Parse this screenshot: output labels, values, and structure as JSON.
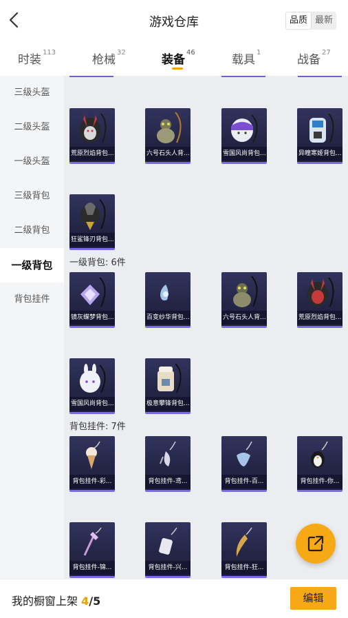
{
  "header": {
    "title": "游戏仓库",
    "sort_options": [
      "品质",
      "最新"
    ],
    "sort_active": "品质"
  },
  "tabs": [
    {
      "label": "时装",
      "count": "113"
    },
    {
      "label": "枪械",
      "count": "32"
    },
    {
      "label": "装备",
      "count": "46",
      "active": true
    },
    {
      "label": "载具",
      "count": "1"
    },
    {
      "label": "战备",
      "count": "27"
    }
  ],
  "sidebar": {
    "items": [
      "三级头盔",
      "二级头盔",
      "一级头盔",
      "三级背包",
      "二级背包",
      "一级背包",
      "背包挂件"
    ],
    "active": "一级背包"
  },
  "sections": {
    "level1_backpack_label": "一级背包: 6件",
    "pendant_label": "背包挂件: 7件"
  },
  "items": {
    "lv2_backpacks": [
      "荒原烈焰背包...",
      "六号石头人背...",
      "雪国风尚背包...",
      "异瞳寒姬背包...",
      "狂鲨锋刃背包..."
    ],
    "lv1_backpacks": [
      "镜灰蝶梦背包...",
      "百变纱华背包...",
      "六号石头人背...",
      "荒原烈焰背包...",
      "雪国风尚背包...",
      "极意攀锋背包..."
    ],
    "pendants": [
      "背包挂件-彩...",
      "背包挂件-鸢...",
      "背包挂件-百...",
      "背包挂件-你...",
      "背包挂件-锦...",
      "背包挂件-兴...",
      "背包挂件-狂..."
    ]
  },
  "bottom": {
    "showcase_label": "我的橱窗上架 ",
    "showcase_count": "4",
    "showcase_sep": "/",
    "showcase_total": "5",
    "edit_label": "编辑"
  },
  "colors": {
    "accent": "#f7a915",
    "card_border": "#7b69e8",
    "card_bg": "#252647"
  }
}
